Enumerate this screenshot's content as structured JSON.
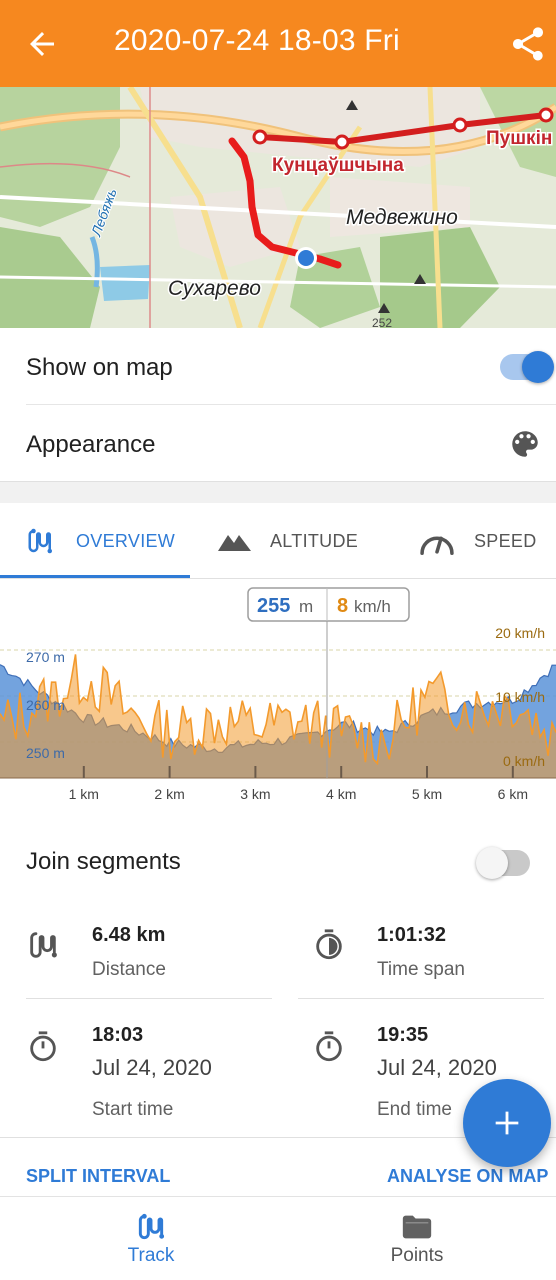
{
  "appbar": {
    "title": "2020-07-24 18-03 Fri",
    "color": "#f6881f"
  },
  "map": {
    "labels": [
      "Кунцаўшчына",
      "Пушкін",
      "Медвежино",
      "Сухарево",
      "Лебяжь",
      "252"
    ]
  },
  "settings": {
    "show_on_map": {
      "label": "Show on map",
      "enabled": true
    },
    "appearance": {
      "label": "Appearance"
    }
  },
  "tabs": [
    {
      "label": "OVERVIEW",
      "active": true
    },
    {
      "label": "ALTITUDE",
      "active": false
    },
    {
      "label": "SPEED",
      "active": false
    }
  ],
  "chart_data": {
    "type": "area",
    "readout": {
      "altitude_value": "255",
      "altitude_unit": "m",
      "speed_value": "8",
      "speed_unit": "km/h"
    },
    "x_ticks": [
      "1 km",
      "2 km",
      "3 km",
      "4 km",
      "5 km",
      "6 km"
    ],
    "x": [
      0,
      0.5,
      1,
      1.5,
      2,
      2.5,
      3,
      3.5,
      4,
      4.5,
      5,
      5.5,
      6,
      6.48
    ],
    "y_left_ticks": [
      "270 m",
      "260 m",
      "250 m"
    ],
    "y_right_ticks": [
      "20 km/h",
      "10 km/h",
      "0 km/h"
    ],
    "ylim_altitude": [
      245,
      273
    ],
    "ylim_speed": [
      0,
      20
    ],
    "series": [
      {
        "name": "Altitude",
        "unit": "m",
        "color": "#5a93d8",
        "values": [
          268,
          262,
          257,
          255,
          252,
          251,
          252,
          253,
          256,
          254,
          258,
          260,
          261,
          268
        ]
      },
      {
        "name": "Speed",
        "unit": "km/h",
        "color": "#f39a2d",
        "values": [
          8,
          12,
          16,
          10,
          7,
          9,
          8,
          9,
          7,
          6,
          13,
          11,
          12,
          6
        ]
      }
    ]
  },
  "join_segments": {
    "label": "Join segments",
    "enabled": false
  },
  "stats": {
    "distance": {
      "value": "6.48 km",
      "label": "Distance"
    },
    "time_span": {
      "value": "1:01:32",
      "label": "Time span"
    },
    "start": {
      "time": "18:03",
      "date": "Jul 24, 2020",
      "label": "Start time"
    },
    "end": {
      "time": "19:35",
      "date": "Jul 24, 2020",
      "label": "End time"
    }
  },
  "actions": {
    "split_interval": "SPLIT INTERVAL",
    "analyse_on_map": "ANALYSE ON MAP"
  },
  "bottom_nav": [
    {
      "label": "Track",
      "active": true
    },
    {
      "label": "Points",
      "active": false
    }
  ],
  "colors": {
    "accent": "#2f7bd6",
    "toolbar": "#f6881f",
    "altitude": "#5a93d8",
    "speed": "#f39a2d",
    "track": "#e02020"
  }
}
